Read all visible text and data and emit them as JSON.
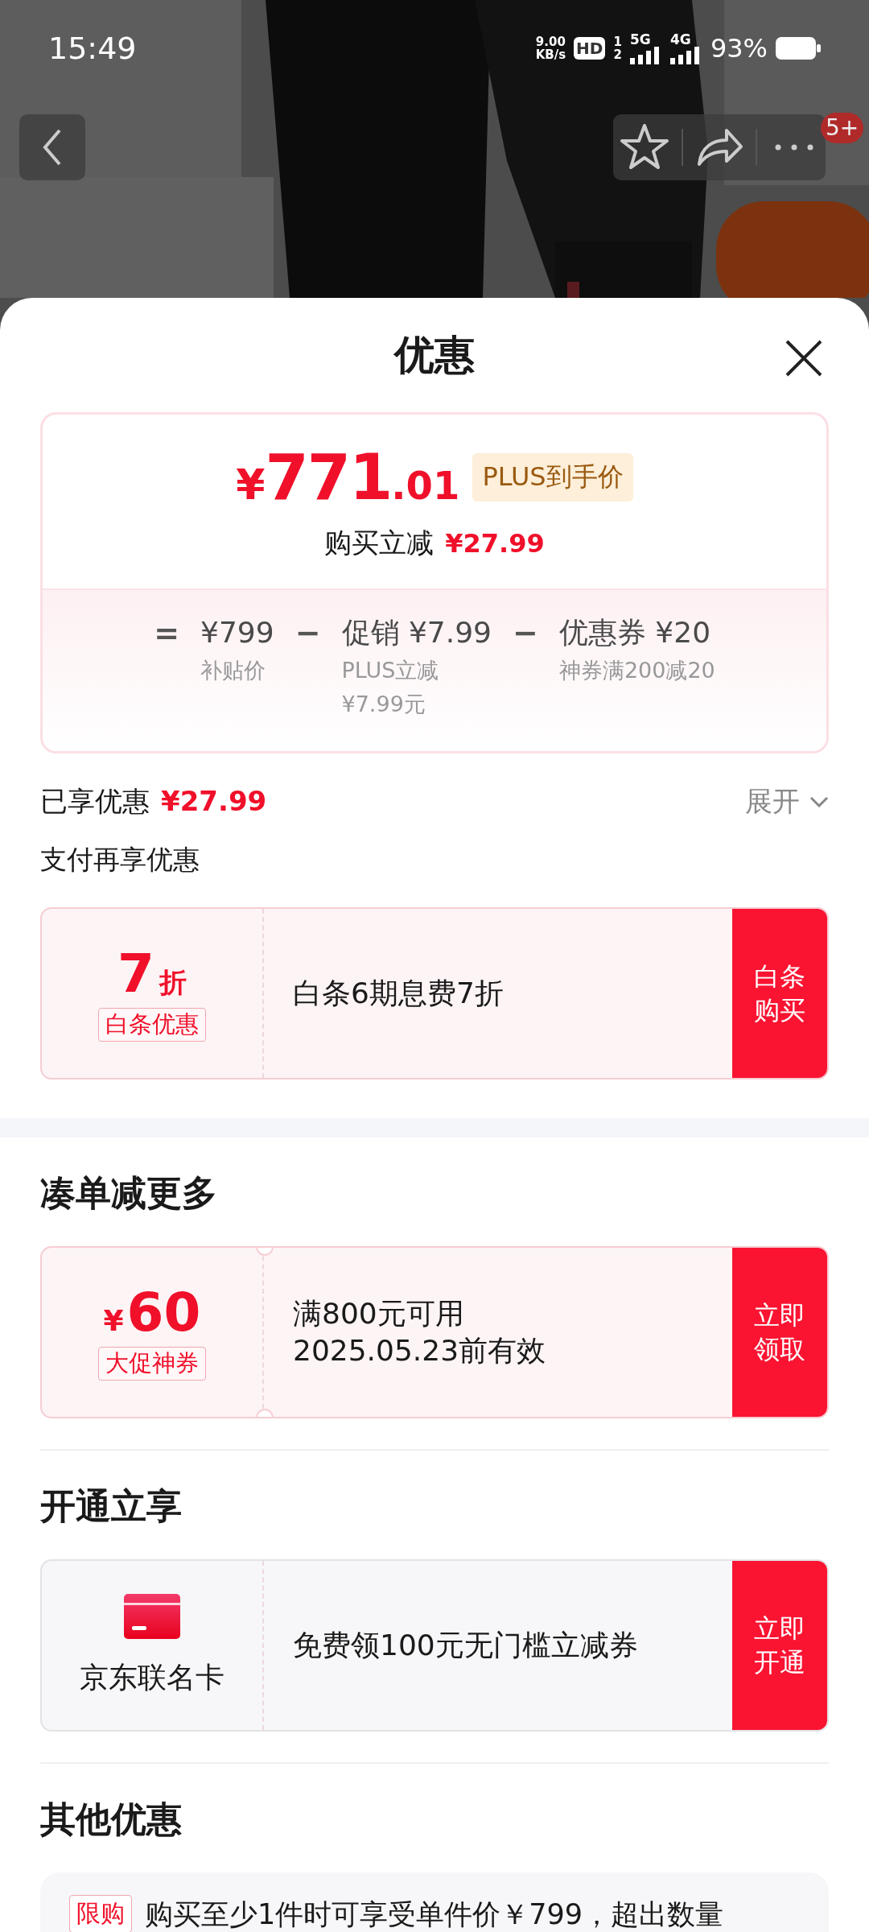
{
  "status_bar": {
    "time": "15:49",
    "net_speed": "9.00",
    "net_unit": "KB/s",
    "hd": "HD",
    "sim1": "1",
    "sim2": "2",
    "net1": "5G",
    "net2": "4G",
    "battery": "93%"
  },
  "top_bar": {
    "badge": "5+"
  },
  "sheet": {
    "title": "优惠"
  },
  "price_card": {
    "symbol": "¥",
    "integer": "771",
    "decimal": ".01",
    "tag": "PLUS到手价",
    "saving_label": "购买立减",
    "saving": "¥27.99",
    "breakdown": [
      {
        "op": "=",
        "amount": "¥799",
        "notes": [
          "补贴价"
        ]
      },
      {
        "op": "−",
        "amount": "促销 ¥7.99",
        "notes": [
          "PLUS立减",
          "¥7.99元"
        ]
      },
      {
        "op": "−",
        "amount": "优惠券 ¥20",
        "notes": [
          "神券满200减20"
        ]
      }
    ]
  },
  "enjoyed": {
    "label": "已享优惠",
    "amount": "¥27.99",
    "toggle": "展开",
    "expanded": false
  },
  "sections": [
    {
      "title": "支付再享优惠",
      "kind": "sub",
      "offers": [
        {
          "kind": "discount",
          "value": "7",
          "unit": "折",
          "tag": "白条优惠",
          "lines": [
            "白条6期息费7折"
          ],
          "action": "白条购买"
        }
      ]
    },
    {
      "title": "凑单减更多",
      "kind": "main",
      "offers": [
        {
          "kind": "coupon",
          "symbol": "¥",
          "value": "60",
          "tag": "大促神券",
          "lines": [
            "满800元可用",
            "2025.05.23前有效"
          ],
          "action": "立即领取"
        }
      ]
    },
    {
      "title": "开通立享",
      "kind": "main",
      "offers": [
        {
          "kind": "card",
          "name": "京东联名卡",
          "lines": [
            "免费领100元无门槛立减券"
          ],
          "action": "立即开通"
        }
      ]
    },
    {
      "title": "其他优惠",
      "kind": "main",
      "notes": [
        {
          "tag": "限购",
          "text": "购买至少1件时可享受单件价￥799，超出数量"
        }
      ]
    }
  ]
}
